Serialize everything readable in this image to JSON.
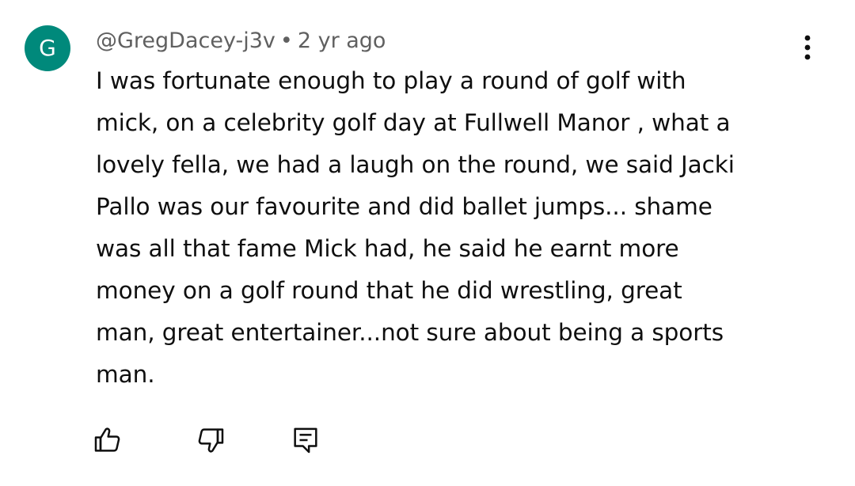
{
  "comment": {
    "avatar_letter": "G",
    "author": "@GregDacey-j3v",
    "separator": "•",
    "time": "2 yr ago",
    "text": "I was fortunate enough to play a round of golf with\nmick, on a celebrity  golf day at Fullwell Manor , what a\nlovely fella, we had a laugh on the round, we said Jacki\nPallo was our favourite and did ballet jumps... shame\nwas all that fame Mick had,  he said he earnt more\nmoney on a golf round that he did wrestling,  great\nman, great entertainer...not sure about being a sports\nman."
  },
  "colors": {
    "avatar_bg": "#00897b",
    "meta_text": "#606060",
    "body_text": "#0f0f0f"
  },
  "icons": {
    "more": "more-vert-icon",
    "like": "thumb-up-icon",
    "dislike": "thumb-down-icon",
    "reply": "reply-comment-icon"
  }
}
